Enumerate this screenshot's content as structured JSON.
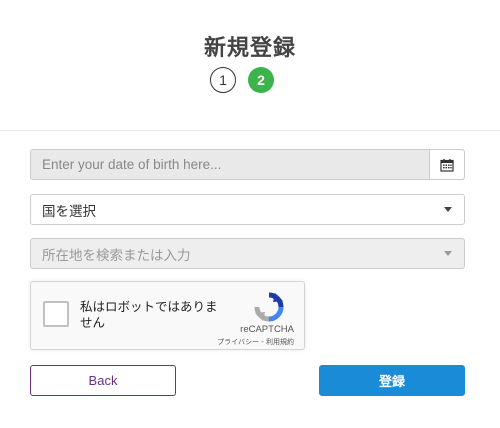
{
  "header": {
    "title": "新規登録"
  },
  "steps": [
    {
      "label": "1",
      "state": "done"
    },
    {
      "label": "2",
      "state": "active"
    }
  ],
  "form": {
    "dob": {
      "placeholder": "Enter your date of birth here...",
      "button_icon": "calendar-icon"
    },
    "country": {
      "value": "国を選択",
      "icon": "caret-down-icon"
    },
    "location": {
      "placeholder": "所在地を検索または入力",
      "disabled": true,
      "icon": "caret-down-icon"
    }
  },
  "recaptcha": {
    "label": "私はロボットではありません",
    "brand": "reCAPTCHA",
    "links": "プライバシー - 利用規約"
  },
  "actions": {
    "back_label": "Back",
    "submit_label": "登録"
  },
  "colors": {
    "step_active": "#3cb44b",
    "back_border": "#6b2f86",
    "submit_bg": "#1a8bd6"
  }
}
